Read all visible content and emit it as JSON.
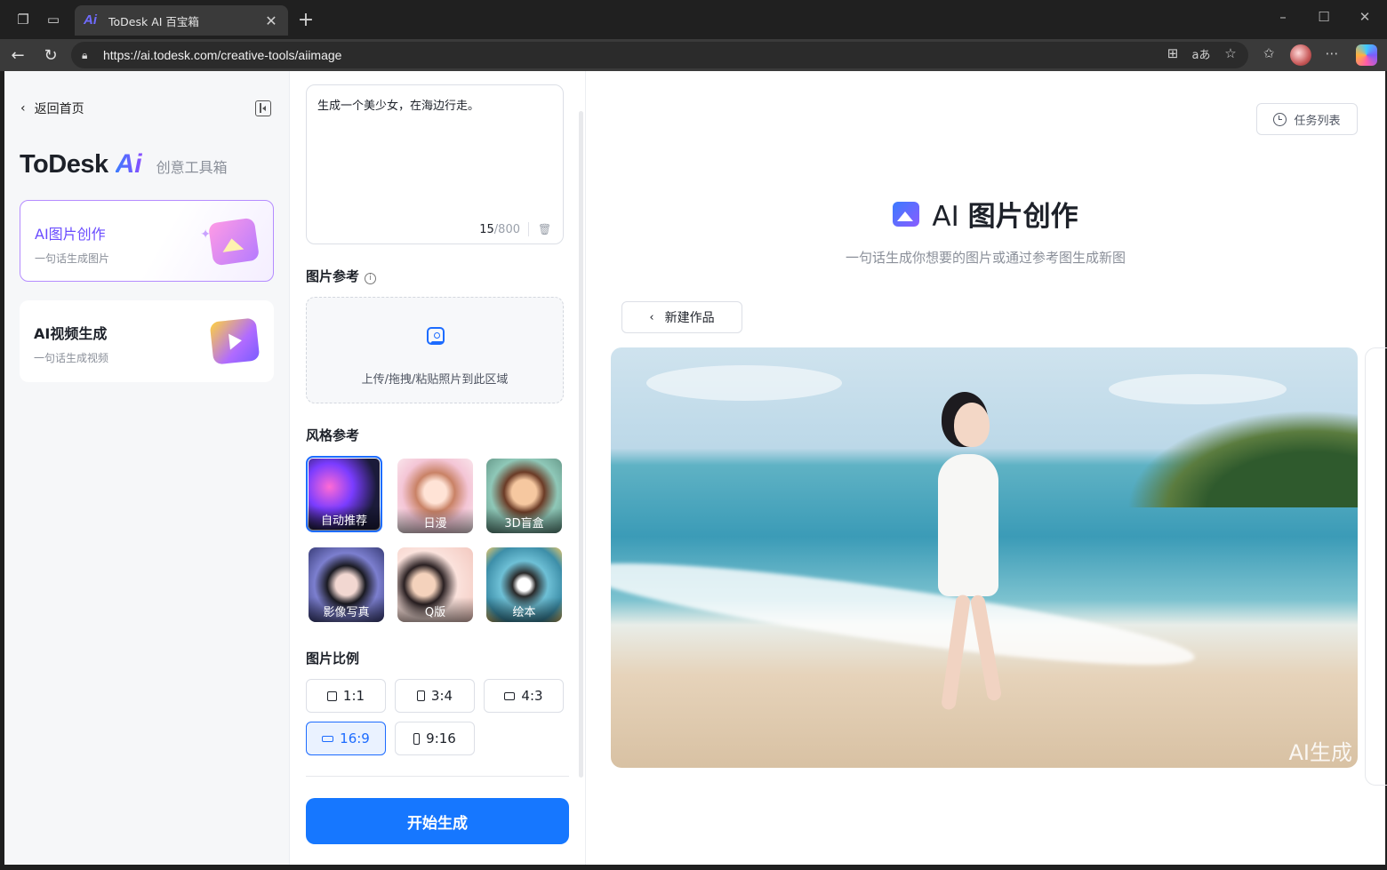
{
  "browser": {
    "tab_title": "ToDesk AI 百宝箱",
    "tab_favicon": "Ai",
    "new_tab": "+",
    "url": "https://ai.todesk.com/creative-tools/aiimage",
    "translate_label": "aあ"
  },
  "sidebar": {
    "back_label": "返回首页",
    "brand_name": "ToDesk",
    "brand_ai": "Ai",
    "brand_sub": "创意工具箱",
    "items": [
      {
        "title": "AI图片创作",
        "desc": "一句话生成图片",
        "icon": "image-create-icon"
      },
      {
        "title": "AI视频生成",
        "desc": "一句话生成视频",
        "icon": "video-create-icon"
      }
    ]
  },
  "panel": {
    "prompt_text": "生成一个美少女，在海边行走。",
    "count": "15",
    "count_max": "/800",
    "image_ref_label": "图片参考",
    "upload_text": "上传/拖拽/粘贴照片到此区域",
    "style_ref_label": "风格参考",
    "styles": [
      "自动推荐",
      "日漫",
      "3D盲盒",
      "影像写真",
      "Q版",
      "绘本"
    ],
    "ratio_label": "图片比例",
    "ratios": [
      "1:1",
      "3:4",
      "4:3",
      "16:9",
      "9:16"
    ],
    "selected_ratio": "16:9",
    "selected_style": "自动推荐",
    "generate_label": "开始生成"
  },
  "main": {
    "task_list_label": "任务列表",
    "hero_prefix": "AI",
    "hero_title": "图片创作",
    "hero_sub": "一句话生成你想要的图片或通过参考图生成新图",
    "new_work_label": "新建作品",
    "watermark": "AI生成"
  },
  "colors": {
    "accent": "#1677ff",
    "active_card_border": "#b58cff",
    "active_card_text": "#6a4cff"
  }
}
